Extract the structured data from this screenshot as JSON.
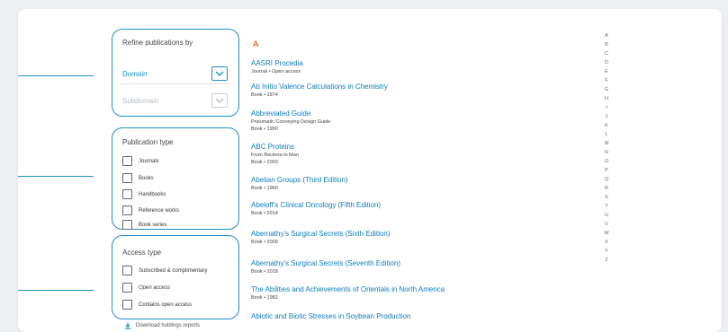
{
  "filters": {
    "refine": {
      "title": "Refine publications by",
      "domain_label": "Domain",
      "subdomain_label": "Subdomain"
    },
    "publication_type": {
      "title": "Publication type",
      "options": [
        "Journals",
        "Books",
        "Handbooks",
        "Reference works",
        "Book series"
      ]
    },
    "access_type": {
      "title": "Access type",
      "options": [
        "Subscribed & complimentary",
        "Open access",
        "Contains open access"
      ]
    },
    "download_label": "Download holdings reports"
  },
  "list": {
    "section_letter": "A",
    "items": [
      {
        "title": "AASRI Procedia",
        "subtitle": "",
        "type": "Journal",
        "meta": "Open access"
      },
      {
        "title": "Ab Initio Valence Calculations in Chemistry",
        "subtitle": "",
        "type": "Book",
        "meta": "1974"
      },
      {
        "title": "Abbreviated Guide",
        "subtitle": "Pneumatic Conveying Design Guide",
        "type": "Book",
        "meta": "1990"
      },
      {
        "title": "ABC Proteins",
        "subtitle": "From Bacteria to Man",
        "type": "Book",
        "meta": "2003"
      },
      {
        "title": "Abelian Groups (Third Edition)",
        "subtitle": "",
        "type": "Book",
        "meta": "1960"
      },
      {
        "title": "Abeloff's Clinical Oncology (Fifth Edition)",
        "subtitle": "",
        "type": "Book",
        "meta": "2014"
      },
      {
        "title": "Abernathy's Surgical Secrets (Sixth Edition)",
        "subtitle": "",
        "type": "Book",
        "meta": "2009"
      },
      {
        "title": "Abernathy's Surgical Secrets (Seventh Edition)",
        "subtitle": "",
        "type": "Book",
        "meta": "2018"
      },
      {
        "title": "The Abilities and Achievements of Orientals in North America",
        "subtitle": "",
        "type": "Book",
        "meta": "1982"
      },
      {
        "title": "Abiotic and Biotic Stresses in Soybean Production",
        "subtitle": "",
        "type": "",
        "meta": ""
      }
    ],
    "separator": "•"
  },
  "az_index": [
    "A",
    "B",
    "C",
    "D",
    "E",
    "F",
    "G",
    "H",
    "I",
    "J",
    "K",
    "L",
    "M",
    "N",
    "O",
    "P",
    "Q",
    "R",
    "S",
    "T",
    "U",
    "V",
    "W",
    "X",
    "Y",
    "Z"
  ],
  "colors": {
    "accent": "#1d8fcc",
    "link": "#0c7dbb",
    "section_letter": "#e9711c",
    "background": "#eeeff1"
  },
  "icons": {
    "dropdown": "chevron-down-icon",
    "download": "download-icon"
  }
}
